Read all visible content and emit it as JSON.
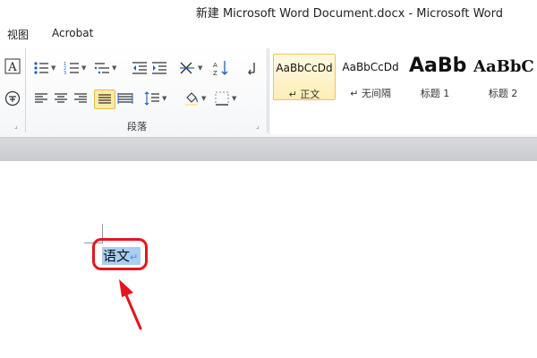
{
  "window": {
    "title": "新建 Microsoft Word Document.docx  -  Microsoft Word"
  },
  "menu": {
    "items": [
      {
        "label": "视图"
      },
      {
        "label": "Acrobat"
      }
    ]
  },
  "ribbon": {
    "paragraph_group_label": "段落",
    "styles": [
      {
        "sample": "AaBbCcDd",
        "name": "↵ 正文",
        "selected": true
      },
      {
        "sample": "AaBbCcDd",
        "name": "↵ 无间隔",
        "selected": false
      },
      {
        "sample": "AaBb",
        "name": "标题 1",
        "selected": false
      },
      {
        "sample": "AaBbC",
        "name": "标题 2",
        "selected": false
      }
    ]
  },
  "document": {
    "text": "语文",
    "paragraph_mark": "↵"
  },
  "colors": {
    "accent_highlight": "#e3161d",
    "selection": "#a9cef3",
    "active_button": "#fde9a8"
  }
}
